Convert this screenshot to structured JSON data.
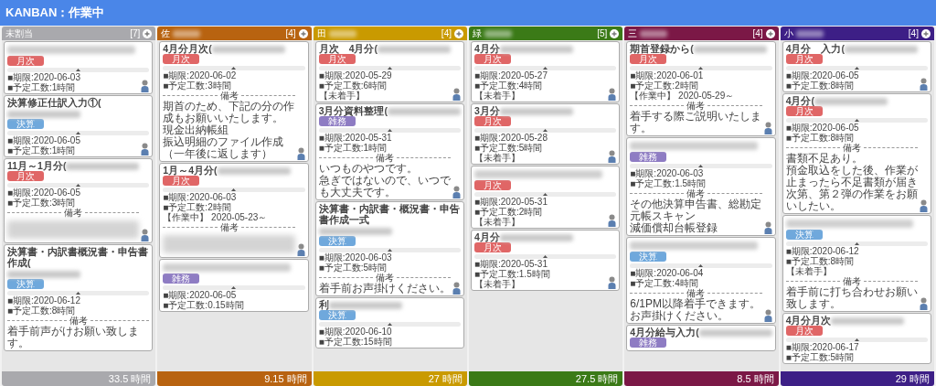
{
  "navbar": {
    "title": "KANBAN：作業中"
  },
  "columns": [
    {
      "name": "未割当",
      "name_redacted": false,
      "count": "[7]",
      "color": "#a9a9ad",
      "total": "33.5 時間",
      "cards": [
        {
          "title_redacted": true,
          "tag": {
            "text": "月次",
            "kind": "monthly"
          },
          "due": "■期限:2020-06-03",
          "hours": "■予定工数:1時間",
          "avatar": true
        },
        {
          "title": "決算修正仕訳入力①(",
          "title_redacted": true,
          "tag": {
            "text": "決算",
            "kind": "settlement"
          },
          "due": "■期限:2020-06-05",
          "hours": "■予定工数:1時間",
          "avatar": true
        },
        {
          "title": "11月～1月分(",
          "title_redacted": true,
          "tag": {
            "text": "月次",
            "kind": "monthly"
          },
          "due": "■期限:2020-06-05",
          "hours": "■予定工数:3時間",
          "notes_label": "備考",
          "notes_redacted": true,
          "avatar": true
        },
        {
          "title": "決算書・内訳書概況書・申告書作成(",
          "title_redacted": true,
          "tag": {
            "text": "決算",
            "kind": "settlement"
          },
          "due": "■期限:2020-06-12",
          "hours": "■予定工数:8時間",
          "notes_label": "備考",
          "notes": [
            "着手前声がけお願い致します。"
          ]
        }
      ]
    },
    {
      "name": "佐",
      "name_redacted": true,
      "count": "[4]",
      "color": "#b86310",
      "total": "9.15 時間",
      "cards": [
        {
          "title": "4月分月次(",
          "title_redacted": true,
          "tag": {
            "text": "月次",
            "kind": "monthly"
          },
          "due": "■期限:2020-06-02",
          "hours": "■予定工数:3時間",
          "notes_label": "備考",
          "notes": [
            "期首のため、下記の分の作成もお願いいたします。",
            "現金出納帳組",
            "振込明細のファイル作成（一年後に返します）"
          ],
          "avatar": true
        },
        {
          "title": "1月～4月分(",
          "title_redacted": true,
          "tag": {
            "text": "月次",
            "kind": "monthly"
          },
          "due": "■期限:2020-06-03",
          "hours": "■予定工数:2時間",
          "status": "【作業中】 2020-05-23～",
          "notes_label": "備考",
          "notes_redacted": true,
          "avatar": true
        },
        {
          "title_redacted": true,
          "tag": {
            "text": "雑務",
            "kind": "misc"
          },
          "due": "■期限:2020-06-05",
          "hours": "■予定工数:0.15時間"
        }
      ]
    },
    {
      "name": "田",
      "name_redacted": true,
      "count": "[4]",
      "color": "#c99a00",
      "total": "27 時間",
      "cards": [
        {
          "title": "月次　4月分(",
          "title_redacted": true,
          "tag": {
            "text": "月次",
            "kind": "monthly"
          },
          "due": "■期限:2020-05-29",
          "hours": "■予定工数:6時間",
          "status": "【未着手】",
          "avatar": true
        },
        {
          "title": "3月分資料整理(",
          "title_redacted": true,
          "tag": {
            "text": "雑務",
            "kind": "misc"
          },
          "due": "■期限:2020-05-31",
          "hours": "■予定工数:1時間",
          "notes_label": "備考",
          "notes": [
            "いつものやつです。",
            "急ぎではないので、いつでも大丈夫です。"
          ],
          "avatar": true
        },
        {
          "title": "決算書・内訳書・概況書・申告書作成一式",
          "title_redacted": true,
          "tag": {
            "text": "決算",
            "kind": "settlement"
          },
          "due": "■期限:2020-06-03",
          "hours": "■予定工数:5時間",
          "notes_label": "備考",
          "notes": [
            "着手前お声掛けください。"
          ],
          "avatar": true
        },
        {
          "title": "利",
          "title_redacted": true,
          "tag": {
            "text": "決算",
            "kind": "settlement"
          },
          "due": "■期限:2020-06-10",
          "hours": "■予定工数:15時間"
        }
      ]
    },
    {
      "name": "緑",
      "name_redacted": true,
      "count": "[5]",
      "color": "#3b7a17",
      "total": "27.5 時間",
      "cards": [
        {
          "title": "4月分",
          "title_redacted": true,
          "tag": {
            "text": "月次",
            "kind": "monthly"
          },
          "due": "■期限:2020-05-27",
          "hours": "■予定工数:4時間",
          "status": "【未着手】",
          "avatar": true
        },
        {
          "title": "3月分",
          "title_redacted": true,
          "tag": {
            "text": "月次",
            "kind": "monthly"
          },
          "due": "■期限:2020-05-28",
          "hours": "■予定工数:5時間",
          "status": "【未着手】",
          "avatar": true
        },
        {
          "title_redacted": true,
          "tag": {
            "text": "月次",
            "kind": "monthly"
          },
          "due": "■期限:2020-05-31",
          "hours": "■予定工数:2時間",
          "status": "【未着手】",
          "avatar": true
        },
        {
          "title": "4月分",
          "title_redacted": true,
          "tag": {
            "text": "月次",
            "kind": "monthly"
          },
          "due": "■期限:2020-05-31",
          "hours": "■予定工数:1.5時間",
          "status": "【未着手】",
          "avatar": true
        }
      ]
    },
    {
      "name": "三",
      "name_redacted": true,
      "count": "[4]",
      "color": "#7b1846",
      "total": "8.5 時間",
      "cards": [
        {
          "title": "期首登録から(",
          "title_redacted": true,
          "tag": {
            "text": "月次",
            "kind": "monthly"
          },
          "due": "■期限:2020-06-01",
          "hours": "■予定工数:2時間",
          "status": "【作業中】 2020-05-29～",
          "notes_label": "備考",
          "notes": [
            "着手する際ご説明いたします。"
          ],
          "avatar": true
        },
        {
          "title_redacted": true,
          "tag": {
            "text": "雑務",
            "kind": "misc"
          },
          "due": "■期限:2020-06-03",
          "hours": "■予定工数:1.5時間",
          "notes_label": "備考",
          "notes": [
            "その他決算申告書、総勘定元帳スキャン",
            "減価償却台帳登録"
          ],
          "avatar": true
        },
        {
          "title_redacted": true,
          "tag": {
            "text": "決算",
            "kind": "settlement"
          },
          "due": "■期限:2020-06-04",
          "hours": "■予定工数:4時間",
          "notes_label": "備考",
          "notes": [
            "6/1PM以降着手できます。",
            "お声掛けください。"
          ],
          "avatar": true
        },
        {
          "title": "4月分給与入力(",
          "title_redacted": true,
          "tag": {
            "text": "雑務",
            "kind": "misc"
          }
        }
      ]
    },
    {
      "name": "小",
      "name_redacted": true,
      "count": "[4]",
      "color": "#3d1f86",
      "total": "29 時間",
      "cards": [
        {
          "title": "4月分　入力(",
          "title_redacted": true,
          "tag": {
            "text": "月次",
            "kind": "monthly"
          },
          "due": "■期限:2020-06-05",
          "hours": "■予定工数:8時間",
          "avatar": true
        },
        {
          "title": "4月分(",
          "title_redacted": true,
          "tag": {
            "text": "月次",
            "kind": "monthly"
          },
          "due": "■期限:2020-06-05",
          "hours": "■予定工数:8時間",
          "notes_label": "備考",
          "notes": [
            "書類不足あり。",
            "預金取込をした後、作業が止まったら不足書類が届き次第、第２弾の作業をお願いしたい。"
          ],
          "avatar": true
        },
        {
          "title_redacted": true,
          "tag": {
            "text": "決算",
            "kind": "settlement"
          },
          "due": "■期限:2020-06-12",
          "hours": "■予定工数:8時間",
          "status": "【未着手】",
          "notes_label": "備考",
          "notes": [
            "着手前に打ち合わせお願い致します。"
          ],
          "avatar": true
        },
        {
          "title": "4月分月次",
          "title_redacted": true,
          "tag": {
            "text": "月次",
            "kind": "monthly"
          },
          "due": "■期限:2020-06-17",
          "hours": "■予定工数:5時間"
        }
      ]
    }
  ]
}
